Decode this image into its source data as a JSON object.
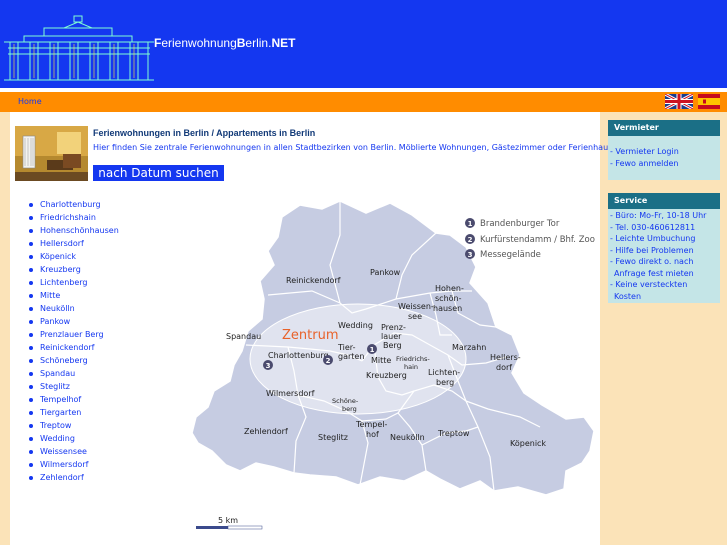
{
  "header": {
    "title_part1": "F",
    "title_part2": "erienwohnung",
    "title_part3": "B",
    "title_part4": "erlin.",
    "title_part5": "NET"
  },
  "nav": {
    "home": "Home"
  },
  "intro": {
    "heading": "Ferienwohnungen in Berlin / Appartements in Berlin",
    "text": "Hier finden Sie zentrale Ferienwohnungen in allen Stadtbezirken von Berlin. Möblierte Wohnungen, Gästezimmer oder Ferienhaus.",
    "date_search": "nach Datum suchen"
  },
  "districts": [
    "Charlottenburg",
    "Friedrichshain",
    "Hohenschönhausen",
    "Hellersdorf",
    "Köpenick",
    "Kreuzberg",
    "Lichtenberg",
    "Mitte",
    "Neukölln",
    "Pankow",
    "Prenzlauer Berg",
    "Reinickendorf",
    "Schöneberg",
    "Spandau",
    "Steglitz",
    "Tempelhof",
    "Tiergarten",
    "Treptow",
    "Wedding",
    "Weissensee",
    "Wilmersdorf",
    "Zehlendorf"
  ],
  "map": {
    "legend": [
      "Brandenburger Tor",
      "Kurfürstendamm / Bhf. Zoo",
      "Messegelände"
    ],
    "legend_numbers": [
      "1",
      "2",
      "3"
    ],
    "zentrum": "Zentrum",
    "labels": {
      "reinickendorf": "Reinickendorf",
      "pankow": "Pankow",
      "spandau": "Spandau",
      "wedding": "Wedding",
      "prenzlauer1": "Prenz-",
      "prenzlauer2": "lauer",
      "prenzlauer3": "Berg",
      "weissensee1": "Weissen-",
      "weissensee2": "see",
      "hohen1": "Hohen-",
      "hohen2": "schön-",
      "hohen3": "hausen",
      "charlottenburg": "Charlottenburg",
      "tiergarten1": "Tier-",
      "tiergarten2": "garten",
      "mitte": "Mitte",
      "friedrichshain1": "Friedrichs-",
      "friedrichshain2": "hain",
      "marzahn": "Marzahn",
      "hellersdorf1": "Hellers-",
      "hellersdorf2": "dorf",
      "kreuzberg": "Kreuzberg",
      "lichtenberg1": "Lichten-",
      "lichtenberg2": "berg",
      "wilmersdorf": "Wilmersdorf",
      "schoeneberg1": "Schöne-",
      "schoeneberg2": "berg",
      "zehlendorf": "Zehlendorf",
      "steglitz": "Steglitz",
      "tempelhof1": "Tempel-",
      "tempelhof2": "hof",
      "neukoelln": "Neukölln",
      "treptow": "Treptow",
      "koepenick": "Köpenick"
    },
    "scale": "5 km"
  },
  "vermieter": {
    "title": "Vermieter",
    "items": [
      "- Vermieter Login",
      "- Fewo anmelden"
    ]
  },
  "service": {
    "title": "Service",
    "lines": [
      "- Büro: Mo-Fr, 10-18 Uhr",
      "- Tel. 030-460612811",
      "- Leichte Umbuchung",
      "- Hilfe bei Problemen",
      "- Fewo direkt o. nach",
      "Anfrage fest mieten",
      "- Keine versteckten",
      "Kosten"
    ]
  },
  "colors": {
    "header": "#1437f0",
    "navbar": "#ff8c00",
    "side": "#fbe3b8",
    "box_head": "#1b6f86",
    "box_body": "#c4e5e7"
  }
}
